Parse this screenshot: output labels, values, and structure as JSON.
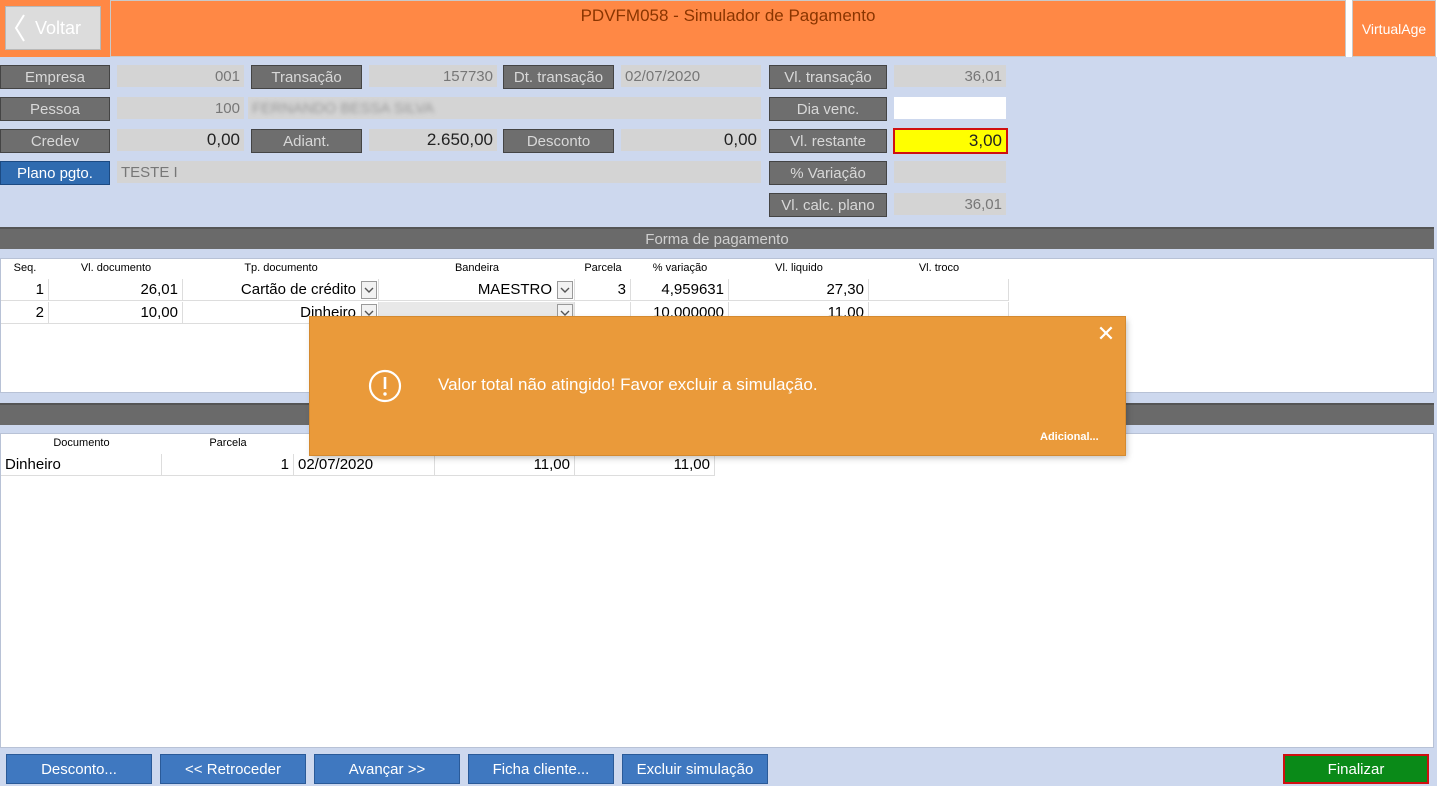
{
  "header": {
    "back_label": "Voltar",
    "title": "PDVFM058 - Simulador de Pagamento",
    "brand_label": "VirtualAge",
    "accent_color": "#ff8845"
  },
  "form": {
    "empresa_label": "Empresa",
    "empresa_value": "001",
    "transacao_label": "Transação",
    "transacao_value": "157730",
    "dt_transacao_label": "Dt. transação",
    "dt_transacao_value": "02/07/2020",
    "vl_transacao_label": "Vl. transação",
    "vl_transacao_value": "36,01",
    "pessoa_label": "Pessoa",
    "pessoa_value": "100",
    "pessoa_name": "FERNANDO BESSA SILVA",
    "dia_venc_label": "Dia venc.",
    "dia_venc_value": "",
    "credev_label": "Credev",
    "credev_value": "0,00",
    "adiant_label": "Adiant.",
    "adiant_value": "2.650,00",
    "desconto_label": "Desconto",
    "desconto_value": "0,00",
    "vl_restante_label": "Vl. restante",
    "vl_restante_value": "3,00",
    "plano_label": "Plano pgto.",
    "plano_value": "TESTE I",
    "variacao_label": "% Variação",
    "variacao_value": "",
    "vl_calc_label": "Vl. calc. plano",
    "vl_calc_value": "36,01"
  },
  "payment_section": {
    "title": "Forma de pagamento",
    "headers": [
      "Seq.",
      "Vl. documento",
      "Tp. documento",
      "Bandeira",
      "Parcela",
      "% variação",
      "Vl. liquido",
      "Vl. troco"
    ],
    "rows": [
      {
        "seq": "1",
        "vl_documento": "26,01",
        "tp_documento": "Cartão de crédito",
        "bandeira": "MAESTRO",
        "parcela": "3",
        "variacao": "4,959631",
        "vl_liquido": "27,30",
        "vl_troco": ""
      },
      {
        "seq": "2",
        "vl_documento": "10,00",
        "tp_documento": "Dinheiro",
        "bandeira": "",
        "parcela": "",
        "variacao": "10,000000",
        "vl_liquido": "11,00",
        "vl_troco": ""
      }
    ]
  },
  "installments": {
    "headers": [
      "Documento",
      "Parcela"
    ],
    "rows": [
      {
        "documento": "Dinheiro",
        "parcela": "1",
        "data": "02/07/2020",
        "valor": "11,00",
        "valor2": "11,00"
      }
    ]
  },
  "dialog": {
    "message": "Valor total não atingido! Favor excluir a simulação.",
    "more_label": "Adicional...",
    "close_symbol": "✕",
    "icon": "warning-circle-icon"
  },
  "buttons": {
    "desconto": "Desconto...",
    "retroceder": "<< Retroceder",
    "avancar": "Avançar >>",
    "ficha": "Ficha cliente...",
    "excluir": "Excluir simulação",
    "finalizar": "Finalizar"
  }
}
